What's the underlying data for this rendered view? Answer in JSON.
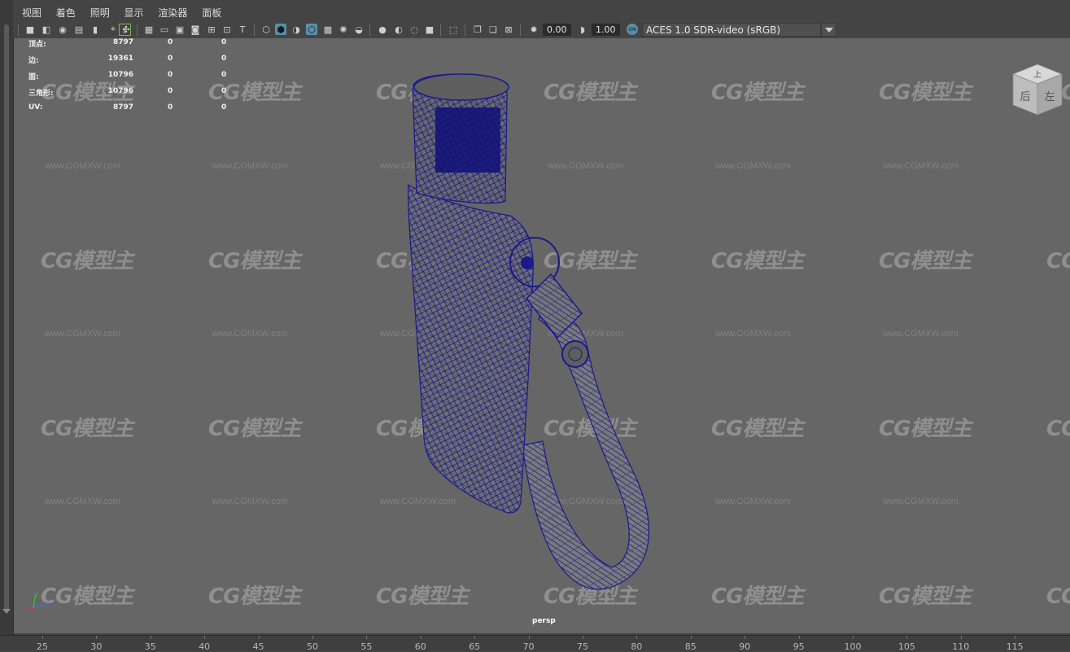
{
  "menu": [
    "视图",
    "着色",
    "照明",
    "显示",
    "渲染器",
    "面板"
  ],
  "toolbar": {
    "exposure_value": "0.00",
    "gamma_value": "1.00",
    "color_management_badge": "ON",
    "color_space": "ACES 1.0 SDR-video (sRGB)",
    "active_color": "#5a8fa6"
  },
  "hud": [
    {
      "label": "顶点:",
      "v1": "8797",
      "v2": "0",
      "v3": "0"
    },
    {
      "label": "边:",
      "v1": "19361",
      "v2": "0",
      "v3": "0"
    },
    {
      "label": "面:",
      "v1": "10796",
      "v2": "0",
      "v3": "0"
    },
    {
      "label": "三角形:",
      "v1": "10796",
      "v2": "0",
      "v3": "0"
    },
    {
      "label": "UV:",
      "v1": "8797",
      "v2": "0",
      "v3": "0"
    }
  ],
  "viewcube": {
    "face_top": "上",
    "face_back": "后",
    "face_side": "左"
  },
  "camera": "persp",
  "axis": {
    "x": "x",
    "y": "y",
    "z": "z"
  },
  "watermark": {
    "logo": "CG模型主",
    "url": "www.CGMXW.com"
  },
  "ruler_ticks": [
    "25",
    "30",
    "35",
    "40",
    "45",
    "50",
    "55",
    "60",
    "65",
    "70",
    "75",
    "80",
    "85",
    "90",
    "95",
    "100",
    "105",
    "110",
    "115"
  ],
  "colors": {
    "viewport_bg": "#666666",
    "wireframe": "#1a1a8c",
    "ui_bg": "#444444"
  }
}
